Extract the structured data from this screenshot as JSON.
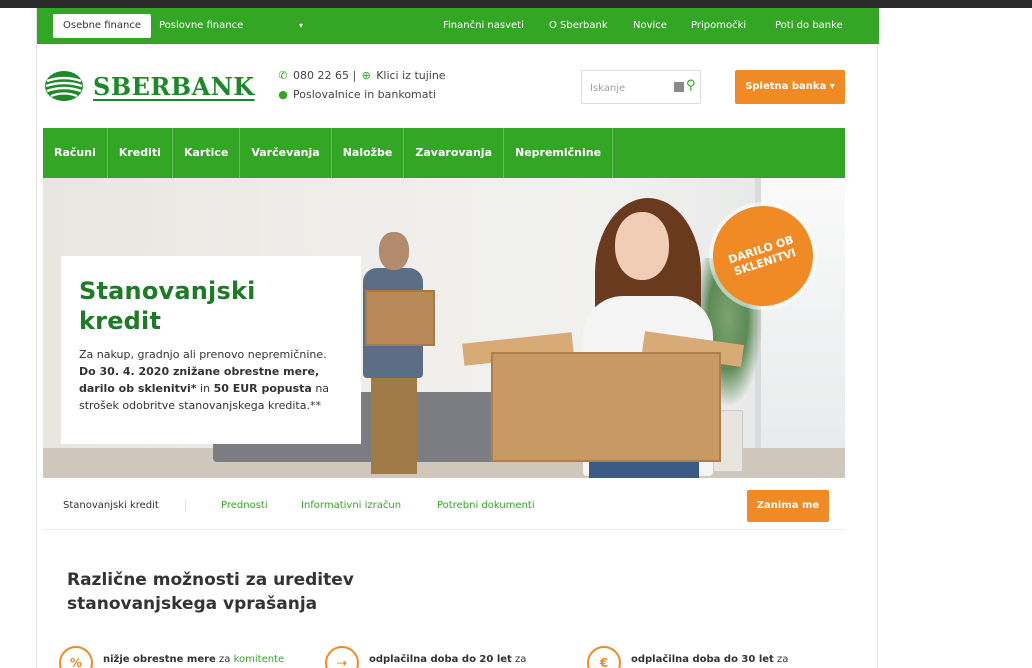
{
  "topbar": {
    "tabs": [
      {
        "label": "Osebne finance",
        "active": true
      },
      {
        "label": "Poslovne finance",
        "active": false
      }
    ],
    "dropdown_glyph": "▾",
    "links": [
      "Finančni nasveti",
      "O Sberbank",
      "Novice",
      "Pripomočki",
      "Poti do banke"
    ]
  },
  "header": {
    "logo_text": "SBERBANK",
    "phone": "080 22 65 |",
    "abroad": "Klici iz tujine",
    "branches": "Poslovalnice in bankomati",
    "search_placeholder": "Iskanje",
    "online_bank": "Spletna banka ▾"
  },
  "mainnav": [
    "Računi",
    "Krediti",
    "Kartice",
    "Varčevanja",
    "Naložbe",
    "Zavarovanja",
    "Nepremičnine"
  ],
  "hero": {
    "badge": "DARILO OB SKLENITVI",
    "title": "Stanovanjski kredit",
    "text_1": "Za nakup, gradnjo ali prenovo nepremičnine. ",
    "text_bold_1": "Do 30. 4. 2020 znižane obrestne mere, darilo ob sklenitvi*",
    "text_2": " in ",
    "text_bold_2": "50 EUR popusta",
    "text_3": " na strošek odobritve stanovanjskega kredita.**"
  },
  "subnav": {
    "current": "Stanovanjski kredit",
    "links": [
      "Prednosti",
      "Informativni izračun",
      "Potrebni dokumenti"
    ],
    "cta": "Zanima me"
  },
  "section": {
    "title": "Različne možnosti za ureditev stanovanjskega vprašanja",
    "features": [
      {
        "bold": "nižje obrestne mere",
        "text": " za ",
        "link": "komitente"
      },
      {
        "bold": "odplačilna doba do 20 let",
        "text": " za",
        "link": ""
      },
      {
        "bold": "odplačilna doba do 30 let",
        "text": " za",
        "link": ""
      }
    ]
  },
  "colors": {
    "brand_green": "#34a626",
    "accent_orange": "#f08a24"
  }
}
